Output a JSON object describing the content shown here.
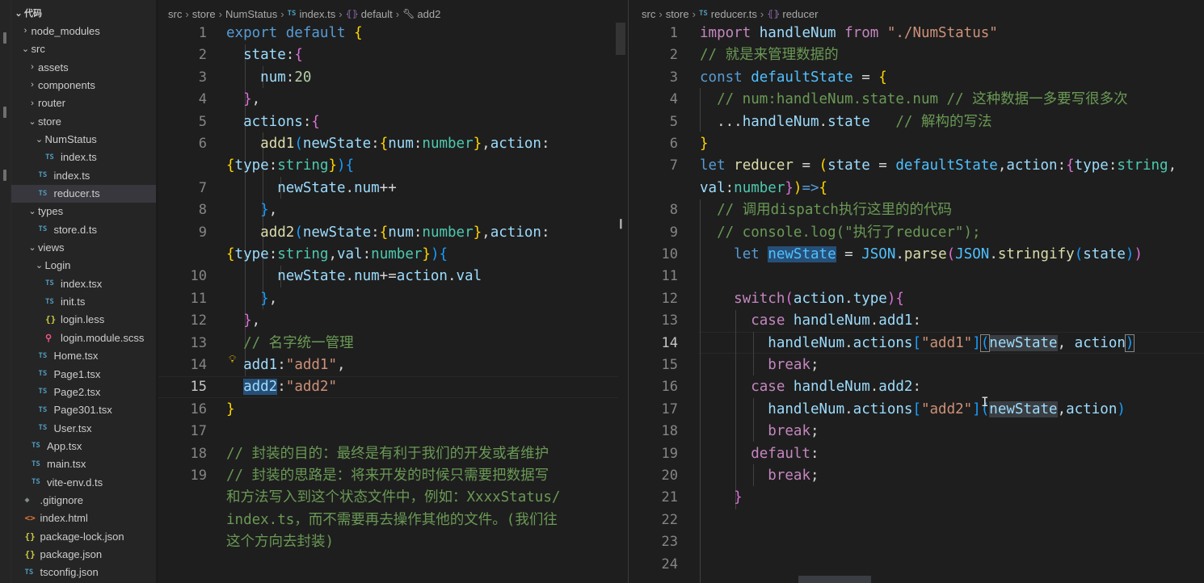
{
  "explorer": {
    "items": [
      {
        "label": "代码",
        "type": "folder",
        "open": true,
        "depth": 0,
        "root": true
      },
      {
        "label": "node_modules",
        "type": "folder",
        "open": false,
        "depth": 1
      },
      {
        "label": "src",
        "type": "folder",
        "open": true,
        "depth": 1
      },
      {
        "label": "assets",
        "type": "folder",
        "open": false,
        "depth": 2
      },
      {
        "label": "components",
        "type": "folder",
        "open": false,
        "depth": 2
      },
      {
        "label": "router",
        "type": "folder",
        "open": false,
        "depth": 2
      },
      {
        "label": "store",
        "type": "folder",
        "open": true,
        "depth": 2
      },
      {
        "label": "NumStatus",
        "type": "folder",
        "open": true,
        "depth": 3
      },
      {
        "label": "index.ts",
        "type": "ts",
        "depth": 4
      },
      {
        "label": "index.ts",
        "type": "ts",
        "depth": 3
      },
      {
        "label": "reducer.ts",
        "type": "ts",
        "depth": 3,
        "selected": true
      },
      {
        "label": "types",
        "type": "folder",
        "open": true,
        "depth": 2
      },
      {
        "label": "store.d.ts",
        "type": "ts",
        "depth": 3
      },
      {
        "label": "views",
        "type": "folder",
        "open": true,
        "depth": 2
      },
      {
        "label": "Login",
        "type": "folder",
        "open": true,
        "depth": 3
      },
      {
        "label": "index.tsx",
        "type": "ts",
        "depth": 4
      },
      {
        "label": "init.ts",
        "type": "ts",
        "depth": 4
      },
      {
        "label": "login.less",
        "type": "json",
        "depth": 4
      },
      {
        "label": "login.module.scss",
        "type": "scss",
        "depth": 4
      },
      {
        "label": "Home.tsx",
        "type": "ts",
        "depth": 3
      },
      {
        "label": "Page1.tsx",
        "type": "ts",
        "depth": 3
      },
      {
        "label": "Page2.tsx",
        "type": "ts",
        "depth": 3
      },
      {
        "label": "Page301.tsx",
        "type": "ts",
        "depth": 3
      },
      {
        "label": "User.tsx",
        "type": "ts",
        "depth": 3
      },
      {
        "label": "App.tsx",
        "type": "ts",
        "depth": 2
      },
      {
        "label": "main.tsx",
        "type": "ts",
        "depth": 2
      },
      {
        "label": "vite-env.d.ts",
        "type": "ts",
        "depth": 2
      },
      {
        "label": ".gitignore",
        "type": "git",
        "depth": 1
      },
      {
        "label": "index.html",
        "type": "html",
        "depth": 1
      },
      {
        "label": "package-lock.json",
        "type": "json",
        "depth": 1
      },
      {
        "label": "package.json",
        "type": "json",
        "depth": 1
      },
      {
        "label": "tsconfig.json",
        "type": "ts",
        "depth": 1
      }
    ]
  },
  "left_editor": {
    "breadcrumb": {
      "part1": "src",
      "part2": "store",
      "part3": "NumStatus",
      "file": "index.ts",
      "symbol1": "default",
      "symbol2": "add2"
    },
    "line_numbers": [
      {
        "n": "1",
        "row": 0
      },
      {
        "n": "2",
        "row": 1
      },
      {
        "n": "3",
        "row": 2
      },
      {
        "n": "4",
        "row": 3
      },
      {
        "n": "5",
        "row": 4
      },
      {
        "n": "6",
        "row": 5
      },
      {
        "n": "7",
        "row": 7
      },
      {
        "n": "8",
        "row": 8
      },
      {
        "n": "9",
        "row": 9
      },
      {
        "n": "10",
        "row": 11
      },
      {
        "n": "11",
        "row": 12
      },
      {
        "n": "12",
        "row": 13
      },
      {
        "n": "13",
        "row": 14
      },
      {
        "n": "14",
        "row": 15
      },
      {
        "n": "15",
        "row": 16,
        "active": true
      },
      {
        "n": "16",
        "row": 17
      },
      {
        "n": "17",
        "row": 18
      },
      {
        "n": "18",
        "row": 19
      },
      {
        "n": "19",
        "row": 20
      }
    ],
    "lines": [
      [
        [
          "kw",
          "export"
        ],
        [
          "txt",
          " "
        ],
        [
          "kw",
          "default"
        ],
        [
          "txt",
          " "
        ],
        [
          "b1",
          "{"
        ]
      ],
      [
        [
          "txt",
          "  "
        ],
        [
          "var",
          "state"
        ],
        [
          "txt",
          ":"
        ],
        [
          "b2",
          "{"
        ]
      ],
      [
        [
          "txt",
          "    "
        ],
        [
          "var",
          "num"
        ],
        [
          "txt",
          ":"
        ],
        [
          "num",
          "20"
        ]
      ],
      [
        [
          "txt",
          "  "
        ],
        [
          "b2",
          "}"
        ],
        [
          "txt",
          ","
        ]
      ],
      [
        [
          "txt",
          "  "
        ],
        [
          "var",
          "actions"
        ],
        [
          "txt",
          ":"
        ],
        [
          "b2",
          "{"
        ]
      ],
      [
        [
          "txt",
          "    "
        ],
        [
          "fn",
          "add1"
        ],
        [
          "b3",
          "("
        ],
        [
          "var",
          "newState"
        ],
        [
          "txt",
          ":"
        ],
        [
          "b1",
          "{"
        ],
        [
          "var",
          "num"
        ],
        [
          "txt",
          ":"
        ],
        [
          "typ",
          "number"
        ],
        [
          "b1",
          "}"
        ],
        [
          "txt",
          ","
        ],
        [
          "var",
          "action"
        ],
        [
          "txt",
          ":"
        ]
      ],
      [
        [
          "b1",
          "{"
        ],
        [
          "var",
          "type"
        ],
        [
          "txt",
          ":"
        ],
        [
          "typ",
          "string"
        ],
        [
          "b1",
          "}"
        ],
        [
          "b3",
          ")"
        ],
        [
          "b3",
          "{"
        ]
      ],
      [
        [
          "txt",
          "      "
        ],
        [
          "var",
          "newState"
        ],
        [
          "txt",
          "."
        ],
        [
          "var",
          "num"
        ],
        [
          "txt",
          "++"
        ]
      ],
      [
        [
          "txt",
          "    "
        ],
        [
          "b3",
          "}"
        ],
        [
          "txt",
          ","
        ]
      ],
      [
        [
          "txt",
          "    "
        ],
        [
          "fn",
          "add2"
        ],
        [
          "b3",
          "("
        ],
        [
          "var",
          "newState"
        ],
        [
          "txt",
          ":"
        ],
        [
          "b1",
          "{"
        ],
        [
          "var",
          "num"
        ],
        [
          "txt",
          ":"
        ],
        [
          "typ",
          "number"
        ],
        [
          "b1",
          "}"
        ],
        [
          "txt",
          ","
        ],
        [
          "var",
          "action"
        ],
        [
          "txt",
          ":"
        ]
      ],
      [
        [
          "b1",
          "{"
        ],
        [
          "var",
          "type"
        ],
        [
          "txt",
          ":"
        ],
        [
          "typ",
          "string"
        ],
        [
          "txt",
          ","
        ],
        [
          "var",
          "val"
        ],
        [
          "txt",
          ":"
        ],
        [
          "typ",
          "number"
        ],
        [
          "b1",
          "}"
        ],
        [
          "b3",
          ")"
        ],
        [
          "b3",
          "{"
        ]
      ],
      [
        [
          "txt",
          "      "
        ],
        [
          "var",
          "newState"
        ],
        [
          "txt",
          "."
        ],
        [
          "var",
          "num"
        ],
        [
          "txt",
          "+="
        ],
        [
          "var",
          "action"
        ],
        [
          "txt",
          "."
        ],
        [
          "var",
          "val"
        ]
      ],
      [
        [
          "txt",
          "    "
        ],
        [
          "b3",
          "}"
        ],
        [
          "txt",
          ","
        ]
      ],
      [
        [
          "txt",
          "  "
        ],
        [
          "b2",
          "}"
        ],
        [
          "txt",
          ","
        ]
      ],
      [
        [
          "txt",
          "  "
        ],
        [
          "cmt",
          "// 名字统一管理"
        ]
      ],
      [
        [
          "txt",
          "  "
        ],
        [
          "var",
          "add1"
        ],
        [
          "txt",
          ":"
        ],
        [
          "str",
          "\"add1\""
        ],
        [
          "txt",
          ","
        ]
      ],
      [
        [
          "txt",
          "  "
        ],
        [
          "var hl-word",
          "add2"
        ],
        [
          "txt",
          ":"
        ],
        [
          "str",
          "\"add2\""
        ]
      ],
      [
        [
          "b1",
          "}"
        ]
      ],
      [
        [
          "txt",
          ""
        ]
      ],
      [
        [
          "cmt",
          "// 封装的目的：最终是有利于我们的开发或者维护"
        ]
      ],
      [
        [
          "cmt",
          "// 封装的思路是：将来开发的时候只需要把数据写"
        ]
      ],
      [
        [
          "cmt",
          "和方法写入到这个状态文件中，例如：XxxxStatus/"
        ]
      ],
      [
        [
          "cmt",
          "index.ts，而不需要再去操作其他的文件。(我们往"
        ]
      ],
      [
        [
          "cmt",
          "这个方向去封装)"
        ]
      ]
    ]
  },
  "right_editor": {
    "breadcrumb": {
      "part1": "src",
      "part2": "store",
      "file": "reducer.ts",
      "symbol1": "reducer"
    },
    "line_numbers": [
      {
        "n": "1",
        "row": 0
      },
      {
        "n": "2",
        "row": 1
      },
      {
        "n": "3",
        "row": 2
      },
      {
        "n": "4",
        "row": 3
      },
      {
        "n": "5",
        "row": 4
      },
      {
        "n": "6",
        "row": 5
      },
      {
        "n": "7",
        "row": 6
      },
      {
        "n": "8",
        "row": 8
      },
      {
        "n": "9",
        "row": 9
      },
      {
        "n": "10",
        "row": 10
      },
      {
        "n": "11",
        "row": 11
      },
      {
        "n": "12",
        "row": 12
      },
      {
        "n": "13",
        "row": 13
      },
      {
        "n": "14",
        "row": 14,
        "active": true
      },
      {
        "n": "15",
        "row": 15
      },
      {
        "n": "16",
        "row": 16
      },
      {
        "n": "17",
        "row": 17
      },
      {
        "n": "18",
        "row": 18
      },
      {
        "n": "19",
        "row": 19
      },
      {
        "n": "20",
        "row": 20
      },
      {
        "n": "21",
        "row": 21
      },
      {
        "n": "22",
        "row": 22
      },
      {
        "n": "23",
        "row": 23
      },
      {
        "n": "24",
        "row": 24
      }
    ],
    "lines": [
      [
        [
          "ctl",
          "import"
        ],
        [
          "txt",
          " "
        ],
        [
          "var",
          "handleNum"
        ],
        [
          "txt",
          " "
        ],
        [
          "ctl",
          "from"
        ],
        [
          "txt",
          " "
        ],
        [
          "str",
          "\"./NumStatus\""
        ]
      ],
      [
        [
          "cmt",
          "// 就是来管理数据的"
        ]
      ],
      [
        [
          "kw",
          "const"
        ],
        [
          "txt",
          " "
        ],
        [
          "cst",
          "defaultState"
        ],
        [
          "txt",
          " = "
        ],
        [
          "b1",
          "{"
        ]
      ],
      [
        [
          "txt",
          "  "
        ],
        [
          "cmt",
          "// num:handleNum.state.num // 这种数据一多要写很多次"
        ]
      ],
      [
        [
          "txt",
          "  ..."
        ],
        [
          "var",
          "handleNum"
        ],
        [
          "txt",
          "."
        ],
        [
          "var",
          "state"
        ],
        [
          "txt",
          "   "
        ],
        [
          "cmt",
          "// 解构的写法"
        ]
      ],
      [
        [
          "b1",
          "}"
        ]
      ],
      [
        [
          "kw",
          "let"
        ],
        [
          "txt",
          " "
        ],
        [
          "fn",
          "reducer"
        ],
        [
          "txt",
          " = "
        ],
        [
          "b1",
          "("
        ],
        [
          "var",
          "state"
        ],
        [
          "txt",
          " = "
        ],
        [
          "cst",
          "defaultState"
        ],
        [
          "txt",
          ","
        ],
        [
          "var",
          "action"
        ],
        [
          "txt",
          ":"
        ],
        [
          "b2",
          "{"
        ],
        [
          "var",
          "type"
        ],
        [
          "txt",
          ":"
        ],
        [
          "typ",
          "string"
        ],
        [
          "txt",
          ","
        ]
      ],
      [
        [
          "var",
          "val"
        ],
        [
          "txt",
          ":"
        ],
        [
          "typ",
          "number"
        ],
        [
          "b2",
          "}"
        ],
        [
          "b1",
          ")"
        ],
        [
          "kw",
          "=>"
        ],
        [
          "b1",
          "{"
        ]
      ],
      [
        [
          "txt",
          "  "
        ],
        [
          "cmt",
          "// 调用dispatch执行这里的的代码"
        ]
      ],
      [
        [
          "txt",
          "  "
        ],
        [
          "cmt",
          "// console.log(\"执行了reducer\");"
        ]
      ],
      [
        [
          "txt",
          "    "
        ],
        [
          "kw",
          "let"
        ],
        [
          "txt",
          " "
        ],
        [
          "cst hl-word",
          "newState"
        ],
        [
          "txt",
          " = "
        ],
        [
          "cst",
          "JSON"
        ],
        [
          "txt",
          "."
        ],
        [
          "fn",
          "parse"
        ],
        [
          "b2",
          "("
        ],
        [
          "cst",
          "JSON"
        ],
        [
          "txt",
          "."
        ],
        [
          "fn",
          "stringify"
        ],
        [
          "b3",
          "("
        ],
        [
          "var",
          "state"
        ],
        [
          "b3",
          ")"
        ],
        [
          "b2",
          ")"
        ]
      ],
      [
        [
          "txt",
          ""
        ]
      ],
      [
        [
          "txt",
          "    "
        ],
        [
          "ctl",
          "switch"
        ],
        [
          "b2",
          "("
        ],
        [
          "var",
          "action"
        ],
        [
          "txt",
          "."
        ],
        [
          "var",
          "type"
        ],
        [
          "b2",
          ")"
        ],
        [
          "b2",
          "{"
        ]
      ],
      [
        [
          "txt",
          "      "
        ],
        [
          "ctl",
          "case"
        ],
        [
          "txt",
          " "
        ],
        [
          "var",
          "handleNum"
        ],
        [
          "txt",
          "."
        ],
        [
          "var",
          "add1"
        ],
        [
          "txt",
          ":"
        ]
      ],
      [
        [
          "txt",
          "        "
        ],
        [
          "var",
          "handleNum"
        ],
        [
          "txt",
          "."
        ],
        [
          "var",
          "actions"
        ],
        [
          "b3",
          "["
        ],
        [
          "str",
          "\"add1\""
        ],
        [
          "b3",
          "]"
        ],
        [
          "b3 bracket-box",
          "("
        ],
        [
          "var hl-sel",
          "newState"
        ],
        [
          "txt",
          ", "
        ],
        [
          "var",
          "action"
        ],
        [
          "b3 bracket-box",
          ")"
        ]
      ],
      [
        [
          "txt",
          "        "
        ],
        [
          "ctl",
          "break"
        ],
        [
          "txt",
          ";"
        ]
      ],
      [
        [
          "txt",
          "      "
        ],
        [
          "ctl",
          "case"
        ],
        [
          "txt",
          " "
        ],
        [
          "var",
          "handleNum"
        ],
        [
          "txt",
          "."
        ],
        [
          "var",
          "add2"
        ],
        [
          "txt",
          ":"
        ]
      ],
      [
        [
          "txt",
          "        "
        ],
        [
          "var",
          "handleNum"
        ],
        [
          "txt",
          "."
        ],
        [
          "var",
          "actions"
        ],
        [
          "b3",
          "["
        ],
        [
          "str",
          "\"add2\""
        ],
        [
          "b3",
          "]"
        ],
        [
          "b3",
          "("
        ],
        [
          "var hl-sel",
          "newState"
        ],
        [
          "txt",
          ","
        ],
        [
          "var",
          "action"
        ],
        [
          "b3",
          ")"
        ]
      ],
      [
        [
          "txt",
          "        "
        ],
        [
          "ctl",
          "break"
        ],
        [
          "txt",
          ";"
        ]
      ],
      [
        [
          "txt",
          "      "
        ],
        [
          "ctl",
          "default"
        ],
        [
          "txt",
          ":"
        ]
      ],
      [
        [
          "txt",
          "        "
        ],
        [
          "ctl",
          "break"
        ],
        [
          "txt",
          ";"
        ]
      ],
      [
        [
          "txt",
          "    "
        ],
        [
          "b2",
          "}"
        ]
      ],
      [
        [
          "txt",
          ""
        ]
      ],
      [
        [
          "txt",
          ""
        ]
      ],
      [
        [
          "txt",
          ""
        ]
      ]
    ]
  }
}
